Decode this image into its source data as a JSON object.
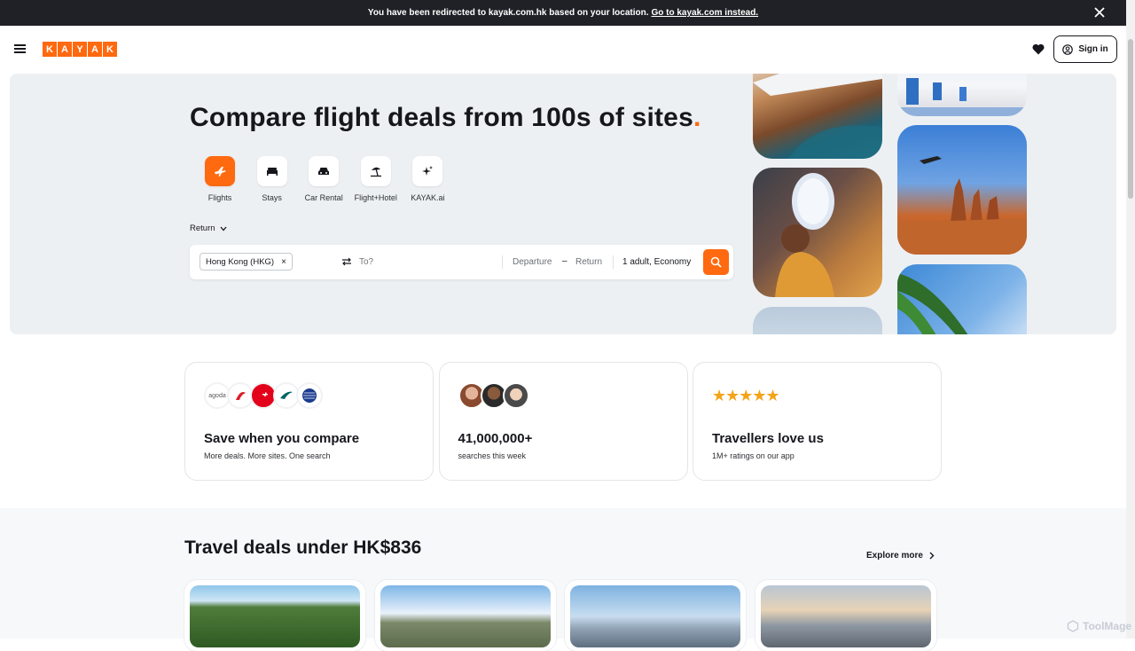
{
  "banner": {
    "message": "You have been redirected to kayak.com.hk based on your location.",
    "link": "Go to kayak.com instead."
  },
  "header": {
    "logo_letters": [
      "K",
      "A",
      "Y",
      "A",
      "K"
    ],
    "sign_in": "Sign in"
  },
  "hero": {
    "title": "Compare flight deals from 100s of sites",
    "title_dot": ".",
    "verticals": [
      {
        "label": "Flights",
        "icon": "plane-icon",
        "active": true
      },
      {
        "label": "Stays",
        "icon": "bed-icon"
      },
      {
        "label": "Car Rental",
        "icon": "car-icon"
      },
      {
        "label": "Flight+Hotel",
        "icon": "beach-umbrella-icon"
      },
      {
        "label": "KAYAK.ai",
        "icon": "sparkle-icon"
      }
    ],
    "trip_type": "Return",
    "search": {
      "origin": "Hong Kong (HKG)",
      "to_placeholder": "To?",
      "departure": "Departure",
      "dash": "–",
      "return": "Return",
      "passengers": "1 adult, Economy"
    }
  },
  "value_cards": [
    {
      "title": "Save when you compare",
      "sub": "More deals. More sites. One search",
      "logo_text": "agoda"
    },
    {
      "title": "41,000,000+",
      "sub": "searches this week"
    },
    {
      "title": "Travellers love us",
      "sub": "1M+ ratings on our app",
      "stars": "★★★★★"
    }
  ],
  "deals": {
    "title": "Travel deals under HK$836",
    "explore": "Explore more"
  },
  "watermark": "ToolMage",
  "colors": {
    "brand": "#ff690f",
    "banner": "#1f2126",
    "hero_bg": "#edf0f3"
  }
}
